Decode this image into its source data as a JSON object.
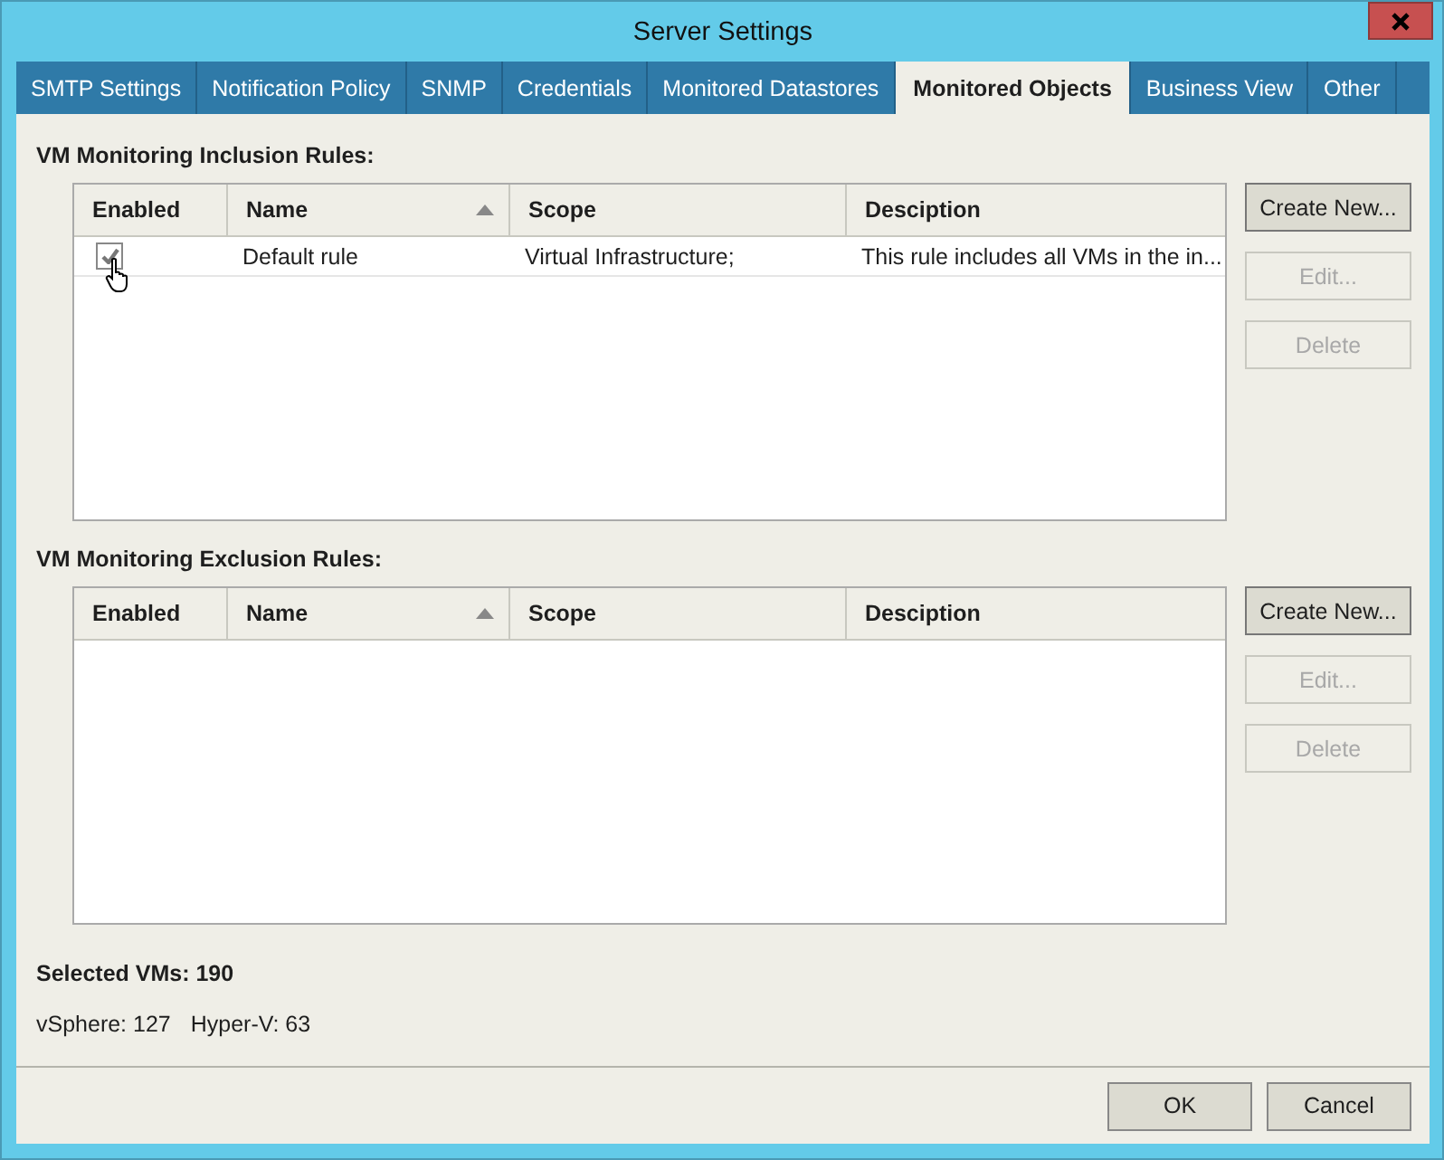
{
  "window": {
    "title": "Server Settings"
  },
  "tabs": [
    {
      "label": "SMTP Settings",
      "selected": false
    },
    {
      "label": "Notification Policy",
      "selected": false
    },
    {
      "label": "SNMP",
      "selected": false
    },
    {
      "label": "Credentials",
      "selected": false
    },
    {
      "label": "Monitored Datastores",
      "selected": false
    },
    {
      "label": "Monitored Objects",
      "selected": true
    },
    {
      "label": "Business View",
      "selected": false
    },
    {
      "label": "Other",
      "selected": false
    }
  ],
  "sections": [
    {
      "title": "VM Monitoring Inclusion Rules:",
      "columns": [
        {
          "label": "Enabled",
          "sorted": false
        },
        {
          "label": "Name",
          "sorted": true
        },
        {
          "label": "Scope",
          "sorted": false
        },
        {
          "label": "Desciption",
          "sorted": false
        }
      ],
      "rows": [
        {
          "enabled": true,
          "name": "Default rule",
          "scope": "Virtual Infrastructure;",
          "description": "This rule includes all VMs in the in..."
        }
      ],
      "buttons": [
        {
          "label": "Create New...",
          "disabled": false
        },
        {
          "label": "Edit...",
          "disabled": true
        },
        {
          "label": "Delete",
          "disabled": true
        }
      ]
    },
    {
      "title": "VM Monitoring Exclusion Rules:",
      "columns": [
        {
          "label": "Enabled",
          "sorted": false
        },
        {
          "label": "Name",
          "sorted": true
        },
        {
          "label": "Scope",
          "sorted": false
        },
        {
          "label": "Desciption",
          "sorted": false
        }
      ],
      "buttons": [
        {
          "label": "Create New...",
          "disabled": false
        },
        {
          "label": "Edit...",
          "disabled": true
        },
        {
          "label": "Delete",
          "disabled": true
        }
      ]
    }
  ],
  "summary": {
    "selected": "Selected VMs: 190",
    "counts": [
      "vSphere: 127",
      "Hyper-V: 63"
    ]
  },
  "footer_buttons": [
    "OK",
    "Cancel"
  ]
}
